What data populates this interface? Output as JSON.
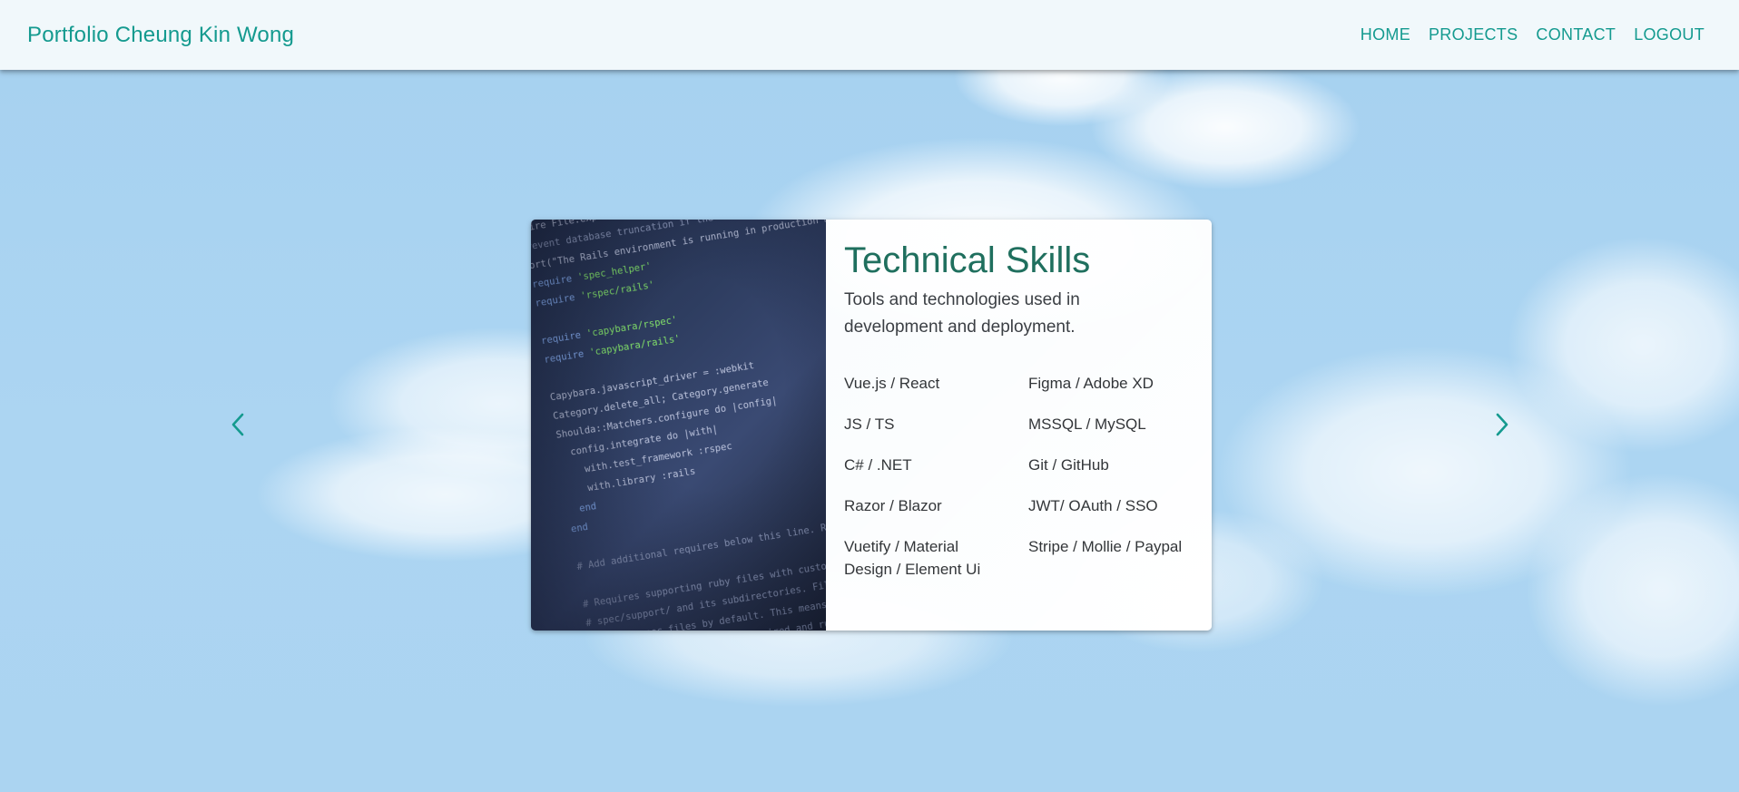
{
  "header": {
    "brand": "Portfolio Cheung Kin Wong",
    "nav": [
      {
        "label": "HOME"
      },
      {
        "label": "PROJECTS"
      },
      {
        "label": "CONTACT"
      },
      {
        "label": "LOGOUT"
      }
    ]
  },
  "carousel": {
    "prev_icon": "chevron-left-icon",
    "next_icon": "chevron-right-icon",
    "card": {
      "image": "code-screen-photo",
      "title": "Technical Skills",
      "subtitle": "Tools and technologies used in development and deployment.",
      "skills": [
        "Vue.js / React",
        "Figma / Adobe XD",
        "JS / TS",
        "MSSQL / MySQL",
        "C# / .NET",
        "Git / GitHub",
        "Razor / Blazor",
        "JWT/ OAuth / SSO",
        "Vuetify / Material Design / Element Ui",
        "Stripe / Mollie / Paypal"
      ]
    }
  },
  "colors": {
    "accent": "#149a8f",
    "title": "#1f6f5e",
    "sky": "#a9d3f1",
    "appbar": "#f1f8fb"
  }
}
